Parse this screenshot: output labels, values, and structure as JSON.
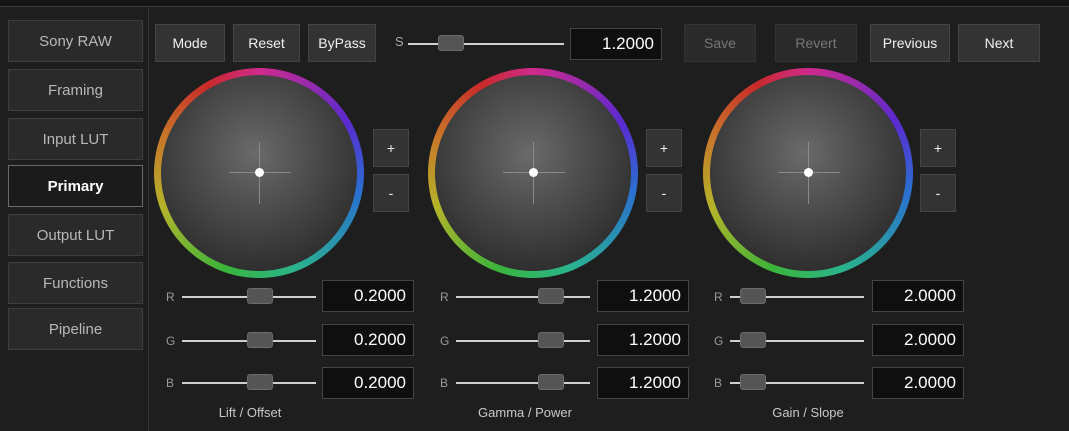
{
  "sidebar": {
    "items": [
      {
        "label": "Sony RAW",
        "active": false
      },
      {
        "label": "Framing",
        "active": false
      },
      {
        "label": "Input LUT",
        "active": false
      },
      {
        "label": "Primary",
        "active": true
      },
      {
        "label": "Output LUT",
        "active": false
      },
      {
        "label": "Functions",
        "active": false
      },
      {
        "label": "Pipeline",
        "active": false
      }
    ]
  },
  "toolbar": {
    "mode_label": "Mode",
    "reset_label": "Reset",
    "bypass_label": "ByPass",
    "s_label": "S",
    "s_value": "1.2000",
    "save_label": "Save",
    "revert_label": "Revert",
    "previous_label": "Previous",
    "next_label": "Next"
  },
  "wheels": [
    {
      "caption": "Lift / Offset",
      "plus": "+",
      "minus": "-",
      "channels": [
        {
          "name": "R",
          "value": "0.2000"
        },
        {
          "name": "G",
          "value": "0.2000"
        },
        {
          "name": "B",
          "value": "0.2000"
        }
      ]
    },
    {
      "caption": "Gamma / Power",
      "plus": "+",
      "minus": "-",
      "channels": [
        {
          "name": "R",
          "value": "1.2000"
        },
        {
          "name": "G",
          "value": "1.2000"
        },
        {
          "name": "B",
          "value": "1.2000"
        }
      ]
    },
    {
      "caption": "Gain / Slope",
      "plus": "+",
      "minus": "-",
      "channels": [
        {
          "name": "R",
          "value": "2.0000"
        },
        {
          "name": "G",
          "value": "2.0000"
        },
        {
          "name": "B",
          "value": "2.0000"
        }
      ]
    }
  ]
}
